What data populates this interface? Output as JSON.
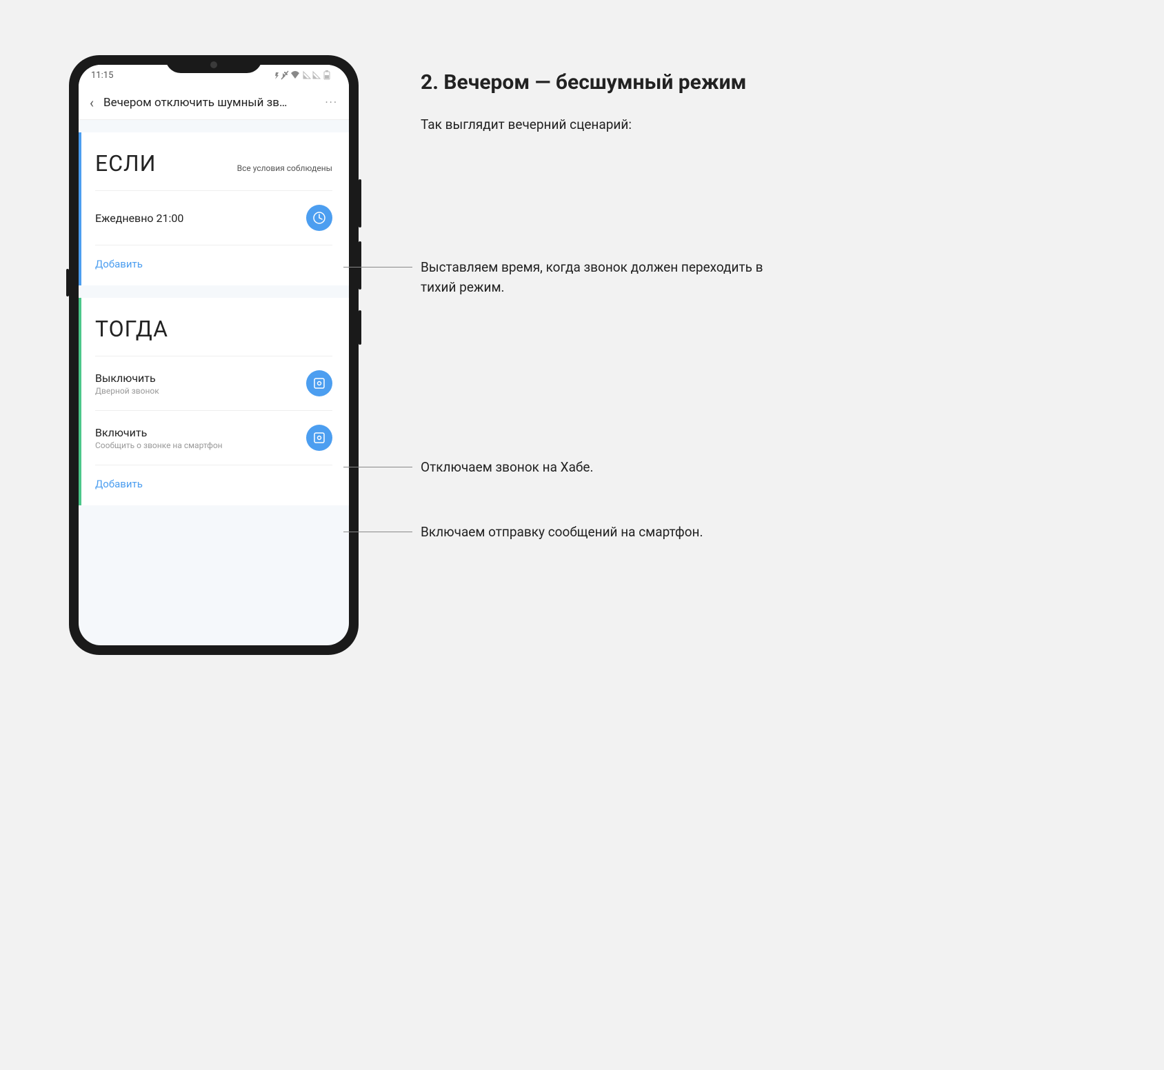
{
  "statusBar": {
    "time": "11:15",
    "icons": "⁂ 🔕 ▼ ◢ ◢ ▮"
  },
  "appBar": {
    "title": "Вечером отключить шумный зв…",
    "back": "‹",
    "more": "···"
  },
  "ifCard": {
    "title": "ЕСЛИ",
    "subtitle": "Все условия соблюдены",
    "schedule": "Ежедневно 21:00",
    "add": "Добавить"
  },
  "thenCard": {
    "title": "ТОГДА",
    "action1": {
      "title": "Выключить",
      "sub": "Дверной звонок"
    },
    "action2": {
      "title": "Включить",
      "sub": "Сообщить о звонке на смартфон"
    },
    "add": "Добавить"
  },
  "annotations": {
    "heading": "2. Вечером — бесшумный режим",
    "intro": "Так выглядит вечерний сценарий:",
    "a1": "Выставляем время, когда звонок должен переходить в тихий режим.",
    "a2": "Отключаем звонок на Хабе.",
    "a3": "Включаем отправку сообщений на смартфон."
  }
}
